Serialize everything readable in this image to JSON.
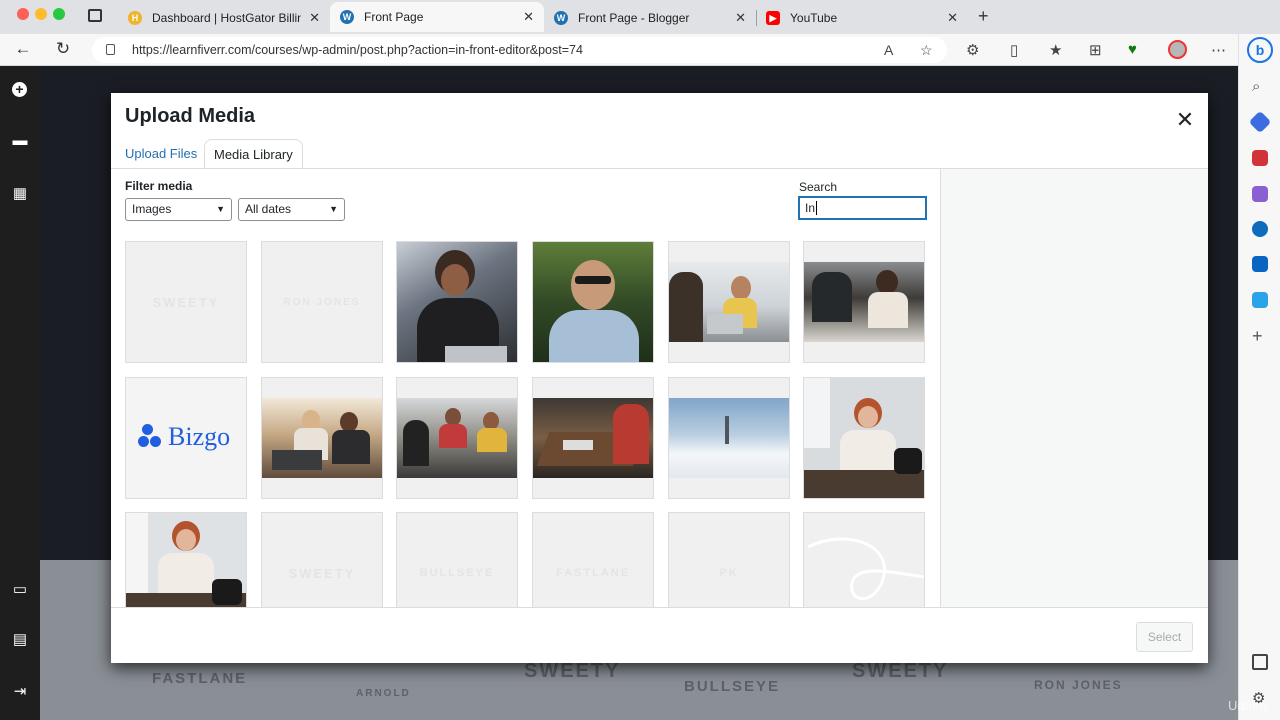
{
  "browser": {
    "tabs": [
      {
        "title": "Dashboard | HostGator Billing/",
        "favicon": "hostgator-icon",
        "color": "#f0b429"
      },
      {
        "title": "Front Page",
        "favicon": "wordpress-icon",
        "color": "#2271b1"
      },
      {
        "title": "Front Page - Blogger",
        "favicon": "wordpress-icon",
        "color": "#2271b1"
      },
      {
        "title": "YouTube",
        "favicon": "youtube-icon",
        "color": "#ff0000"
      }
    ],
    "url": "https://learnfiverr.com/courses/wp-admin/post.php?action=in-front-editor&post=74"
  },
  "modal": {
    "title": "Upload Media",
    "tabs": {
      "upload": "Upload Files",
      "library": "Media Library"
    },
    "filter_label": "Filter media",
    "type_filter": "Images",
    "date_filter": "All dates",
    "search_label": "Search",
    "search_value": "In",
    "select_label": "Select"
  },
  "media_grid": [
    {
      "kind": "logo-placeholder",
      "text": "SWEETY"
    },
    {
      "kind": "logo-placeholder",
      "text": "RON JONES"
    },
    {
      "kind": "photo",
      "subject": "woman with laptop"
    },
    {
      "kind": "photo",
      "subject": "man in sunglasses"
    },
    {
      "kind": "photo",
      "subject": "team meeting"
    },
    {
      "kind": "photo",
      "subject": "team at table"
    },
    {
      "kind": "logo",
      "text": "Bizgo"
    },
    {
      "kind": "photo",
      "subject": "two people at laptop"
    },
    {
      "kind": "photo",
      "subject": "group discussion"
    },
    {
      "kind": "photo",
      "subject": "desk overhead"
    },
    {
      "kind": "photo",
      "subject": "clouds cityscape"
    },
    {
      "kind": "photo",
      "subject": "woman at desk with camera"
    },
    {
      "kind": "photo",
      "subject": "woman at desk"
    },
    {
      "kind": "logo-placeholder",
      "text": "SWEETY"
    },
    {
      "kind": "logo-placeholder",
      "text": "BULLSEYE"
    },
    {
      "kind": "logo-placeholder",
      "text": "FASTLANE"
    },
    {
      "kind": "logo-placeholder",
      "text": "PK"
    },
    {
      "kind": "logo-placeholder",
      "text": ""
    }
  ],
  "background_logos": [
    "FASTLANE",
    "ARNOLD",
    "SWEETY",
    "BULLSEYE",
    "SWEETY",
    "RON JONES"
  ],
  "watermark": "Udemy",
  "colors": {
    "wp_blue": "#2271b1",
    "modal_bg": "#ffffff",
    "rail": "#1e1e1e"
  }
}
